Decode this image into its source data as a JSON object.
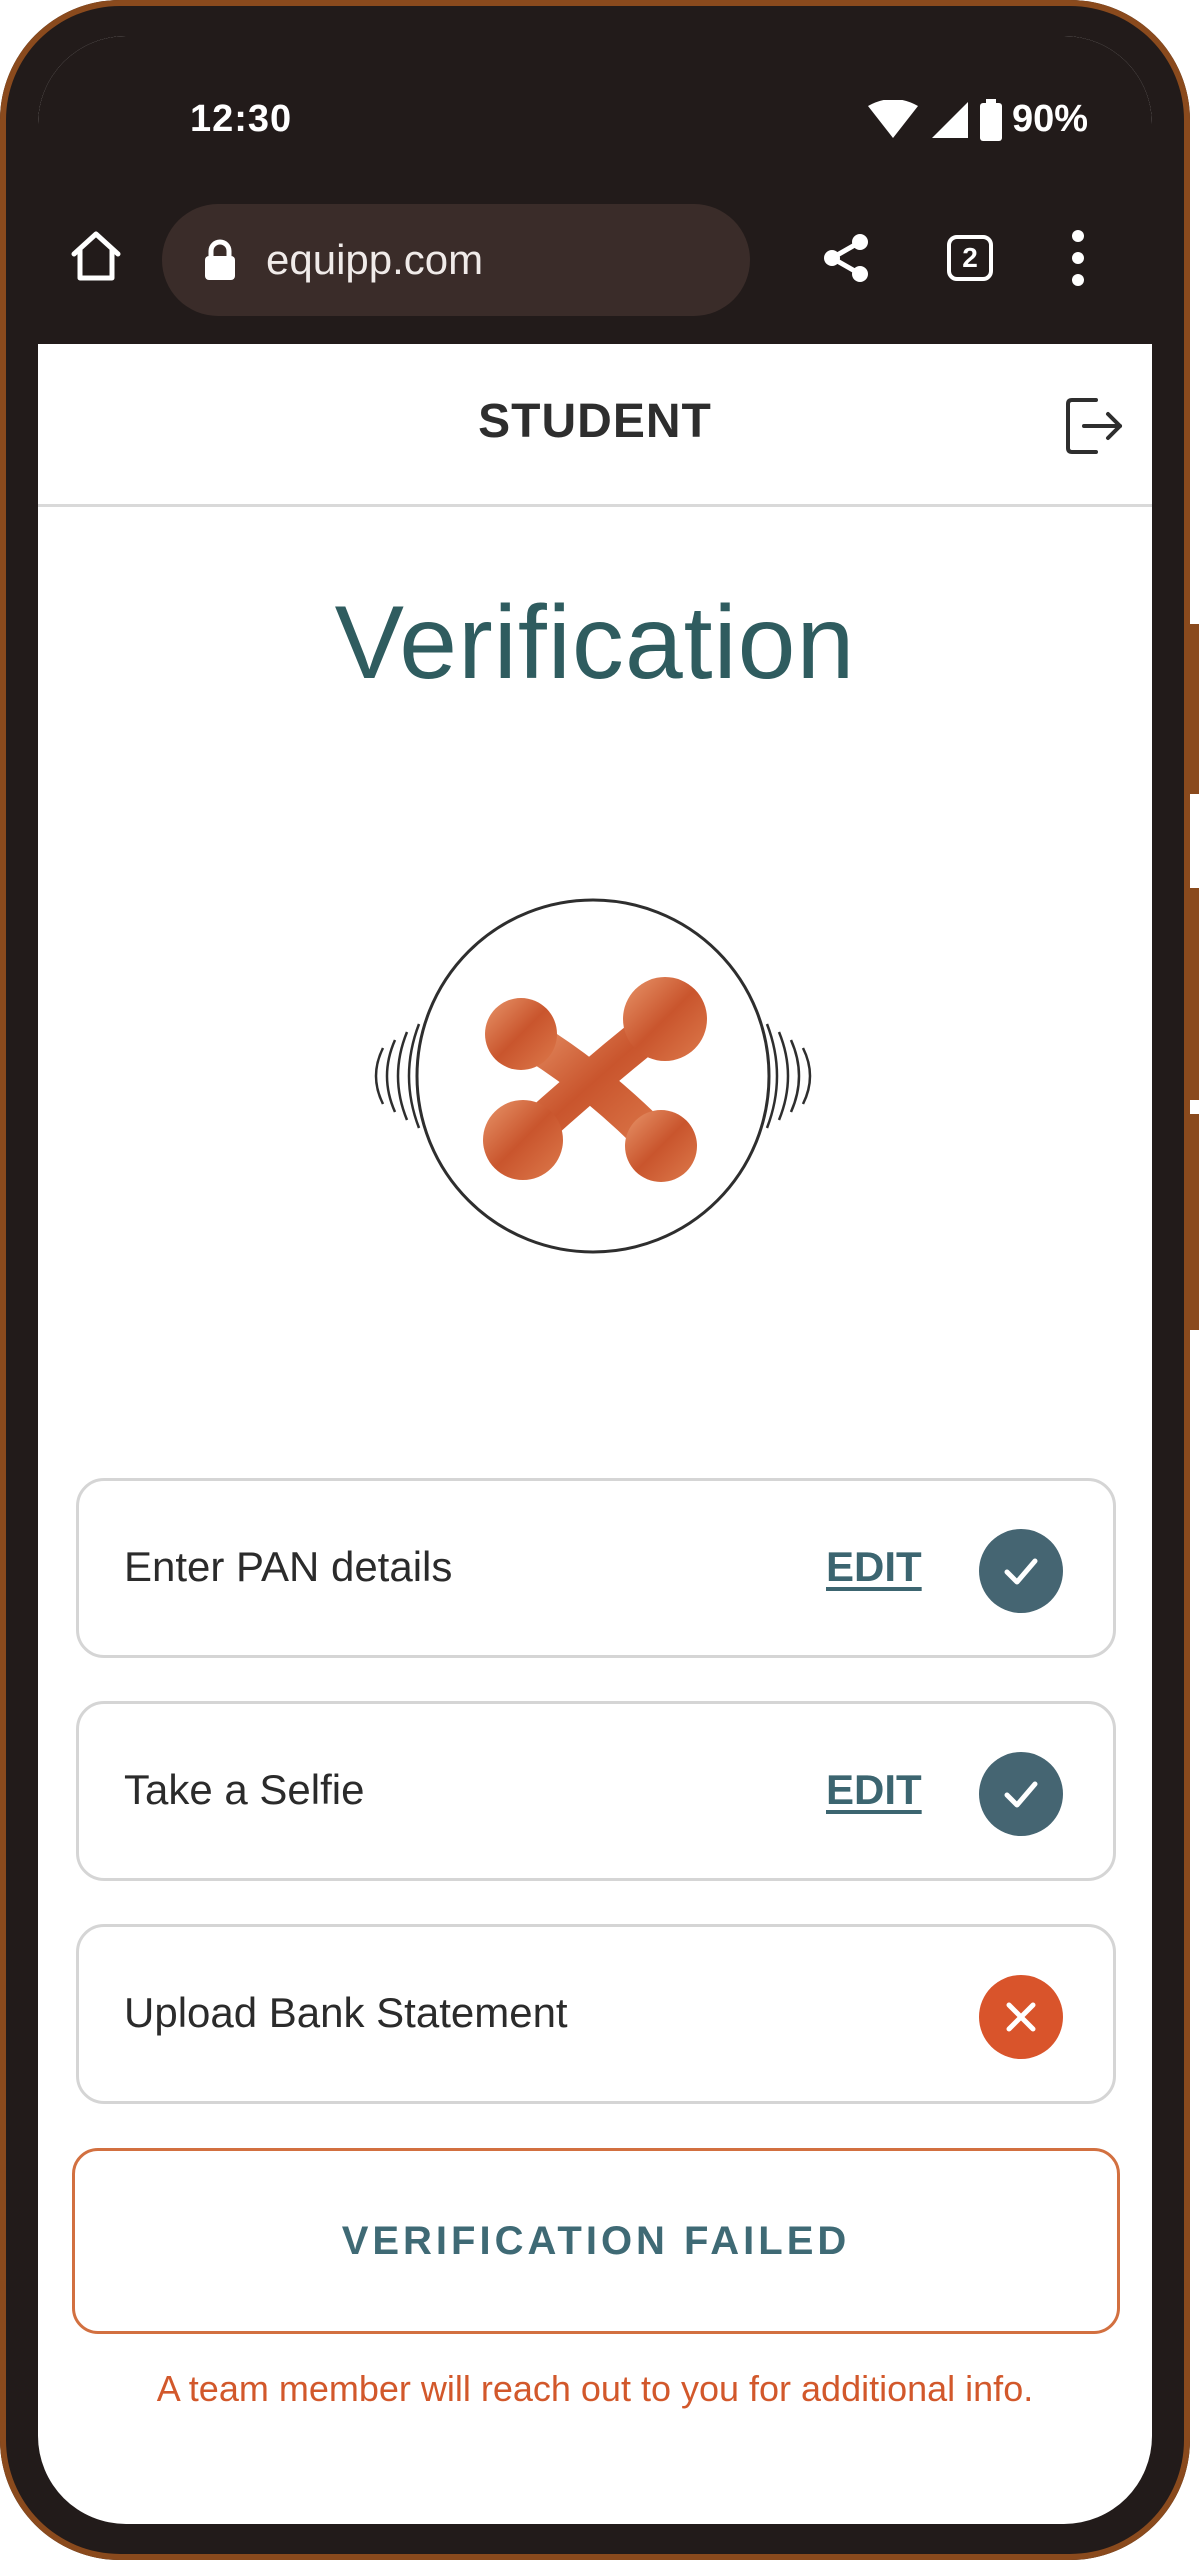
{
  "status_bar": {
    "time": "12:30",
    "battery": "90%",
    "icons": [
      "wifi-icon",
      "signal-icon",
      "battery-icon"
    ]
  },
  "browser": {
    "url": "equipp.com",
    "tab_count": "2",
    "icons": [
      "home-icon",
      "lock-icon",
      "share-icon",
      "tabs-icon",
      "more-vert-icon"
    ]
  },
  "header": {
    "title": "STUDENT",
    "logout_icon": "logout-icon"
  },
  "page": {
    "title": "Verification"
  },
  "steps": [
    {
      "label": "Enter PAN details",
      "edit": "EDIT",
      "status": "complete"
    },
    {
      "label": "Take a Selfie",
      "edit": "EDIT",
      "status": "complete"
    },
    {
      "label": "Upload Bank Statement",
      "edit": "",
      "status": "failed"
    }
  ],
  "result": {
    "label": "VERIFICATION FAILED",
    "note": "A team member will reach out to you for additional info."
  },
  "colors": {
    "accent_teal": "#2f5c5f",
    "ok_badge": "#456572",
    "fail_badge": "#d9542b",
    "fail_text": "#d2582b",
    "chrome_dark": "#221b1a"
  }
}
